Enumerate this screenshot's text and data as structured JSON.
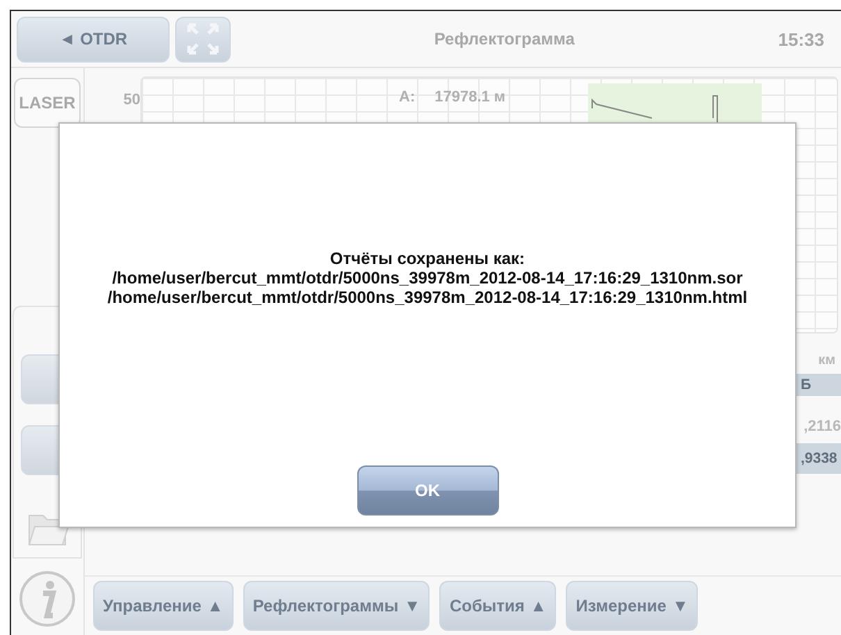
{
  "header": {
    "back_button": "◄ OTDR",
    "title": "Рефлектограмма",
    "time": "15:33"
  },
  "sidebar": {
    "laser_button": "LASER"
  },
  "chart": {
    "y_tick": "50",
    "marker_label": "A:",
    "marker_value": "17978.1 м"
  },
  "side_table": {
    "unit_distance": "км",
    "unit_loss": "Б",
    "values": [
      ",2116",
      ",9338"
    ]
  },
  "toolbar": [
    {
      "label": "Управление",
      "arrow": "▲"
    },
    {
      "label": "Рефлектограммы",
      "arrow": "▼"
    },
    {
      "label": "События",
      "arrow": "▲"
    },
    {
      "label": "Измерение",
      "arrow": "▼"
    }
  ],
  "dialog": {
    "lines": [
      "Отчёты сохранены как:",
      "/home/user/bercut_mmt/otdr/5000ns_39978m_2012-08-14_17:16:29_1310nm.sor",
      "/home/user/bercut_mmt/otdr/5000ns_39978m_2012-08-14_17:16:29_1310nm.html"
    ],
    "button": "OK"
  }
}
